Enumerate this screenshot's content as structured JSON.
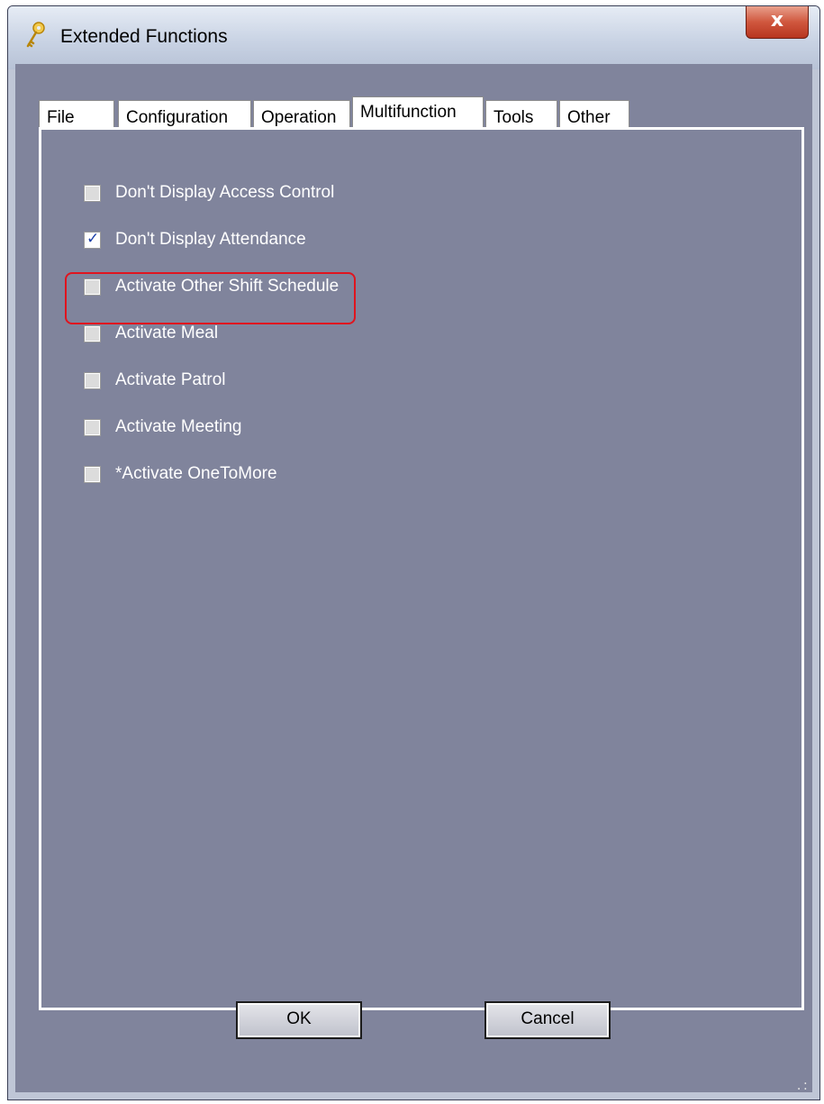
{
  "window": {
    "title": "Extended Functions"
  },
  "title_icon": "key-icon",
  "close_label": "x",
  "tabs": [
    {
      "label": "File",
      "active": false
    },
    {
      "label": "Configuration",
      "active": false
    },
    {
      "label": "Operation",
      "active": false
    },
    {
      "label": "Multifunction",
      "active": true
    },
    {
      "label": "Tools",
      "active": false
    },
    {
      "label": "Other",
      "active": false
    }
  ],
  "options": [
    {
      "label": "Don't Display Access Control",
      "checked": false
    },
    {
      "label": "Don't Display Attendance",
      "checked": true
    },
    {
      "label": "Activate Other Shift Schedule",
      "checked": false
    },
    {
      "label": "Activate Meal",
      "checked": false
    },
    {
      "label": "Activate Patrol",
      "checked": false
    },
    {
      "label": "Activate Meeting",
      "checked": false
    },
    {
      "label": "*Activate OneToMore",
      "checked": false
    }
  ],
  "buttons": {
    "ok_label": "OK",
    "cancel_label": "Cancel"
  },
  "colors": {
    "panel_bg": "#80849c",
    "highlight": "#e0141e",
    "check_accent": "#1b3fa8"
  }
}
